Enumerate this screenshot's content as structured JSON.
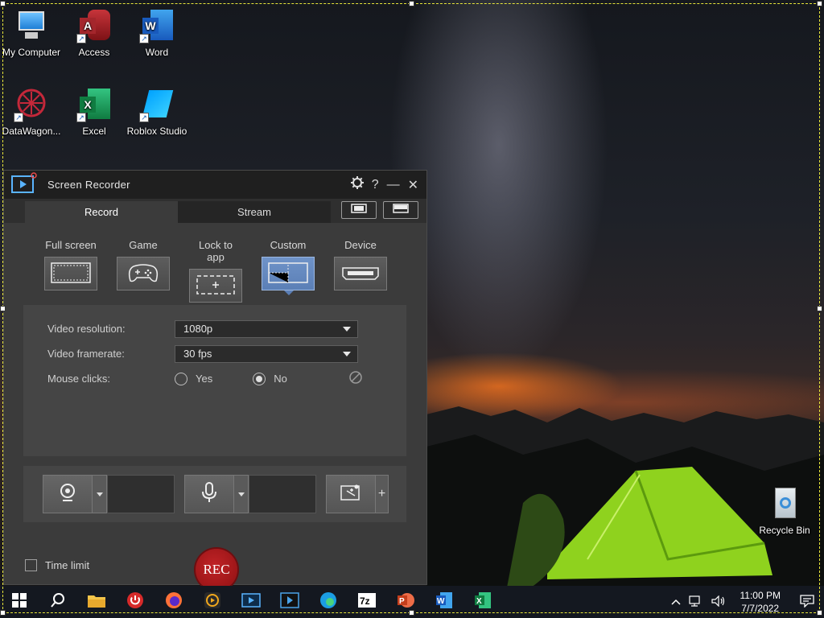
{
  "desktop": {
    "icons": [
      {
        "label": "My Computer",
        "icon": "monitor-icon"
      },
      {
        "label": "Access",
        "icon": "access-icon"
      },
      {
        "label": "Word",
        "icon": "word-icon"
      },
      {
        "label": "DataWagon...",
        "icon": "datawagon-icon"
      },
      {
        "label": "Excel",
        "icon": "excel-icon"
      },
      {
        "label": "Roblox Studio",
        "icon": "roblox-studio-icon"
      },
      {
        "label": "Recycle Bin",
        "icon": "recycle-bin-icon"
      }
    ]
  },
  "recorder": {
    "title": "Screen Recorder",
    "tabs": [
      {
        "label": "Record",
        "active": true
      },
      {
        "label": "Stream",
        "active": false
      }
    ],
    "modes": [
      {
        "label": "Full screen",
        "icon": "full-screen-icon"
      },
      {
        "label": "Game",
        "icon": "gamepad-icon"
      },
      {
        "label": "Lock to app",
        "icon": "lock-to-app-icon"
      },
      {
        "label": "Custom",
        "icon": "custom-region-icon",
        "selected": true
      },
      {
        "label": "Device",
        "icon": "hdmi-device-icon"
      }
    ],
    "settings": {
      "resolution_label": "Video resolution:",
      "resolution_value": "1080p",
      "framerate_label": "Video framerate:",
      "framerate_value": "30 fps",
      "clicks_label": "Mouse clicks:",
      "clicks_yes": "Yes",
      "clicks_no": "No",
      "clicks_selected": "No"
    },
    "time_limit_label": "Time limit",
    "rec_label": "REC",
    "colors": {
      "selected_mode": "#5b7fb6",
      "rec": "#a81a1c"
    }
  },
  "taskbar": {
    "apps": [
      "start-icon",
      "search-icon",
      "file-explorer-icon",
      "power-app-icon",
      "firefox-icon",
      "cyberlink-icon",
      "screen-recorder-icon",
      "video-editor-icon",
      "edge-icon",
      "7zip-icon",
      "powerpoint-icon",
      "word-icon",
      "excel-icon"
    ],
    "time": "11:00 PM",
    "date": "7/7/2022"
  }
}
